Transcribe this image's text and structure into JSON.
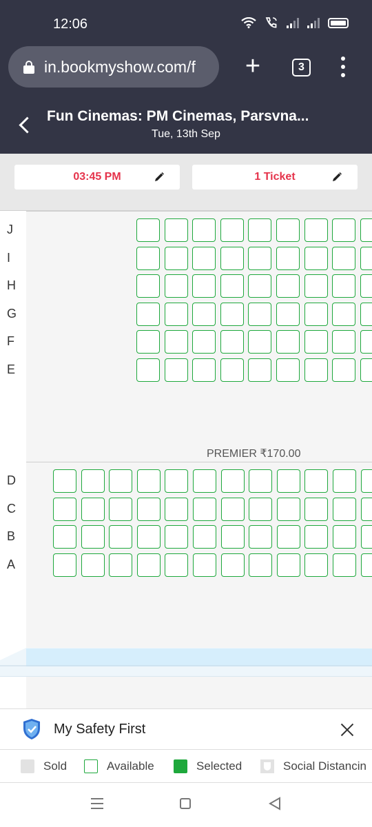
{
  "status_bar": {
    "time": "12:06"
  },
  "browser": {
    "url": "in.bookmyshow.com/f",
    "tab_count": "3"
  },
  "header": {
    "title": "Fun Cinemas: PM Cinemas, Parsvna...",
    "date": "Tue, 13th Sep"
  },
  "selectors": {
    "showtime": "03:45 PM",
    "tickets": "1 Ticket"
  },
  "seat_map": {
    "upper_rows": [
      "J",
      "I",
      "H",
      "G",
      "F",
      "E"
    ],
    "lower_rows": [
      "D",
      "C",
      "B",
      "A"
    ],
    "category_label": "PREMIER ₹170.00",
    "seat_state": "available",
    "colors": {
      "available_border": "#1ea83c",
      "selected_fill": "#1ea83c",
      "sold_fill": "#e2e2e2",
      "screen": "#d6eefc"
    }
  },
  "safety": {
    "label": "My Safety First"
  },
  "legend": {
    "sold": "Sold",
    "available": "Available",
    "selected": "Selected",
    "distancing": "Social Distancin"
  },
  "theme": {
    "header_bg": "#333545",
    "accent": "#e5334b"
  }
}
